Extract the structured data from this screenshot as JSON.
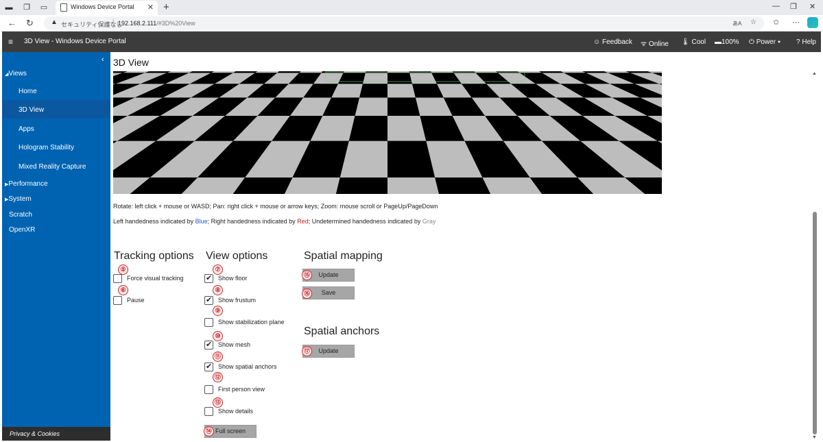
{
  "browser": {
    "tab_title": "Windows Device Portal",
    "security_label": "セキュリティ保護なし",
    "url_host": "192.168.2.111",
    "url_path": "/#3D%20View",
    "reader_label": "あA"
  },
  "header": {
    "title": "3D View - Windows Device Portal",
    "feedback": "Feedback",
    "online": "Online",
    "cool": "Cool",
    "battery": "100%",
    "power": "Power",
    "help": "Help"
  },
  "sidebar": {
    "items": [
      {
        "label": "Views"
      },
      {
        "label": "Home"
      },
      {
        "label": "3D View"
      },
      {
        "label": "Apps"
      },
      {
        "label": "Hologram Stability"
      },
      {
        "label": "Mixed Reality Capture"
      },
      {
        "label": "Performance"
      },
      {
        "label": "System"
      },
      {
        "label": "Scratch"
      },
      {
        "label": "OpenXR"
      }
    ],
    "footer": "Privacy & Cookies"
  },
  "main": {
    "title": "3D View",
    "hint1": "Rotate: left click + mouse or WASD; Pan: right click + mouse or arrow keys; Zoom: mouse scroll or PageUp/PageDown",
    "hint2_prefix": "Left handedness indicated by ",
    "hint2_blue": "Blue",
    "hint2_mid1": "; Right handedness indicated by ",
    "hint2_red": "Red",
    "hint2_mid2": "; Undetermined handedness indicated by ",
    "hint2_gray": "Gray",
    "tracking": {
      "title": "Tracking options",
      "force_visual": "Force visual tracking",
      "pause": "Pause"
    },
    "view": {
      "title": "View options",
      "show_floor": "Show floor",
      "show_frustum": "Show frustum",
      "show_stabilization": "Show stabilization plane",
      "show_mesh": "Show mesh",
      "show_spatial_anchors": "Show spatial anchors",
      "first_person": "First person view",
      "show_details": "Show details",
      "full_screen": "Full screen"
    },
    "spatial_mapping": {
      "title": "Spatial mapping",
      "update": "Update",
      "save": "Save"
    },
    "spatial_anchors": {
      "title": "Spatial anchors",
      "update": "Update"
    }
  },
  "markers": [
    "⑤",
    "⑥",
    "⑦",
    "⑧",
    "⑨",
    "⑩",
    "⑪",
    "⑫",
    "⑬",
    "⑭",
    "⑮",
    "⑯",
    "⑰"
  ],
  "colors": {
    "header_bg": "#3c3c3c",
    "sidebar_bg": "#0063b1",
    "sidebar_selected": "#0c58a0",
    "button_bg": "#a6a6a6",
    "marker": "#c62828"
  }
}
